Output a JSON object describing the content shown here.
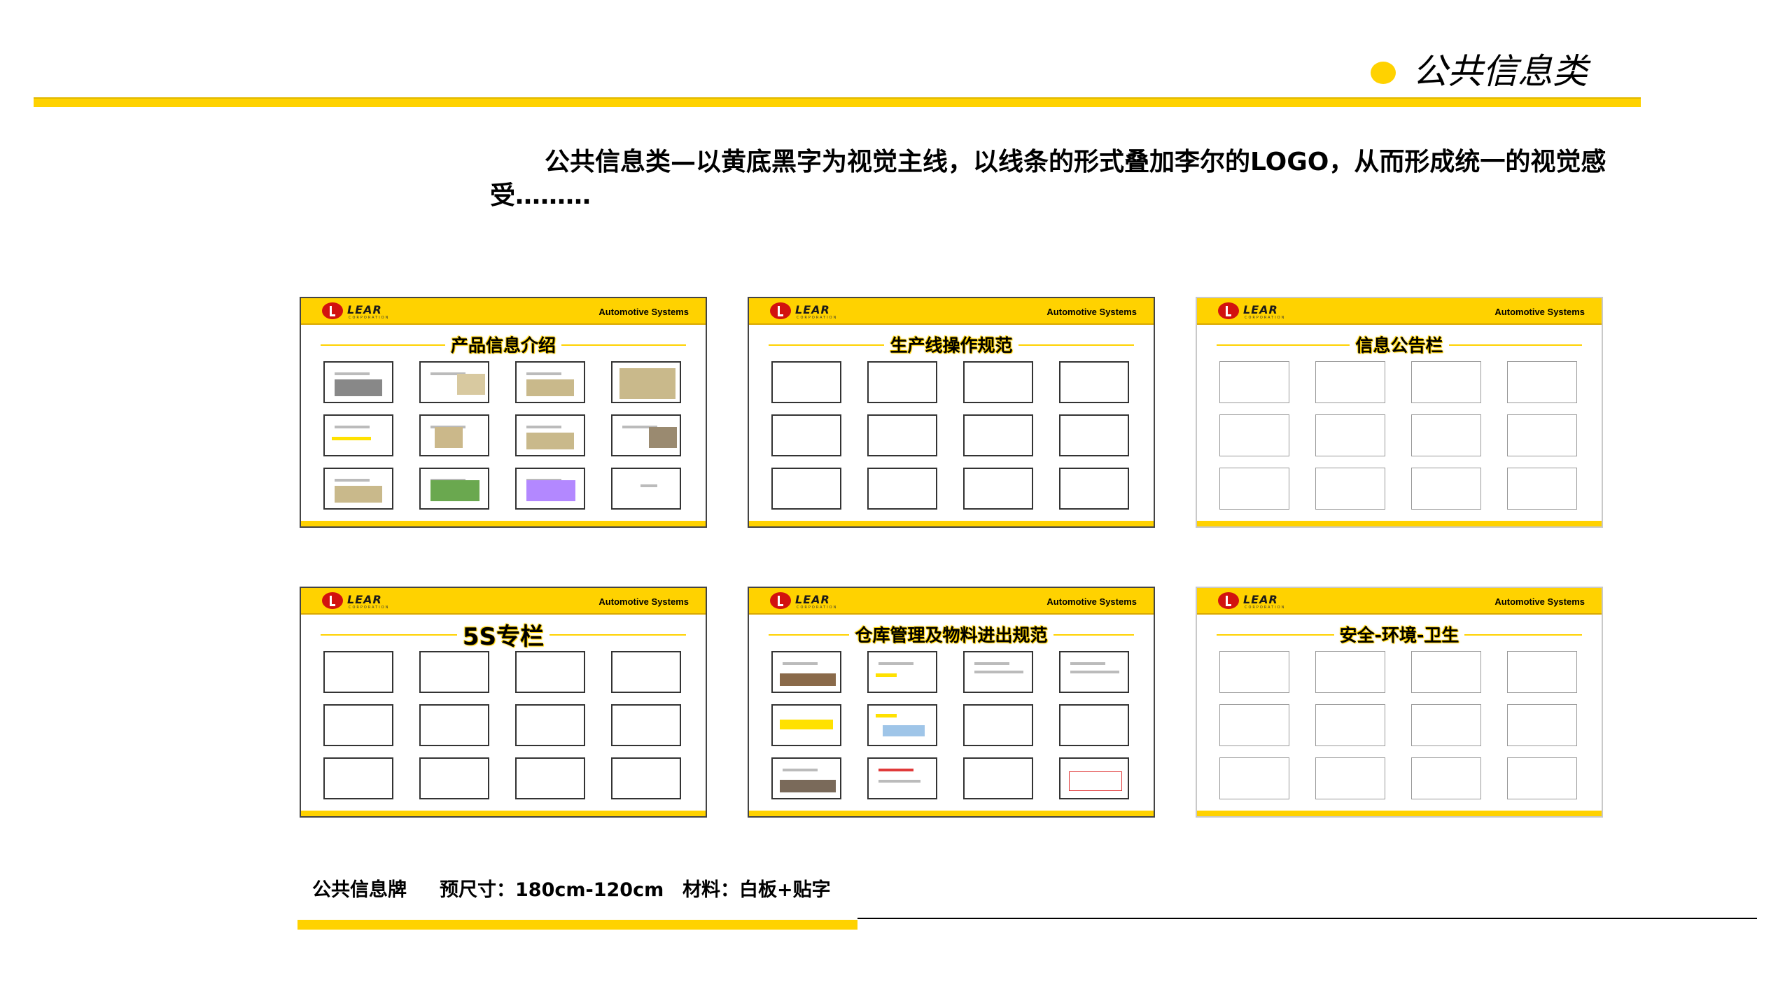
{
  "header": {
    "title": "公共信息类"
  },
  "intro": {
    "text": "公共信息类—以黄底黑字为视觉主线，以线条的形式叠加李尔的LOGO，从而形成统一的视觉感受………"
  },
  "boards": [
    {
      "logo": "LEAR",
      "logo_sub": "CORPORATION",
      "brand": "Automotive Systems",
      "title": "产品信息介绍"
    },
    {
      "logo": "LEAR",
      "logo_sub": "CORPORATION",
      "brand": "Automotive Systems",
      "title": "生产线操作规范"
    },
    {
      "logo": "LEAR",
      "logo_sub": "CORPORATION",
      "brand": "Automotive Systems",
      "title": "信息公告栏"
    },
    {
      "logo": "LEAR",
      "logo_sub": "CORPORATION",
      "brand": "Automotive Systems",
      "title": "5S专栏"
    },
    {
      "logo": "LEAR",
      "logo_sub": "CORPORATION",
      "brand": "Automotive Systems",
      "title": "仓库管理及物料进出规范"
    },
    {
      "logo": "LEAR",
      "logo_sub": "CORPORATION",
      "brand": "Automotive Systems",
      "title": "安全-环境-卫生"
    }
  ],
  "footer": {
    "name": "公共信息牌",
    "size": "预尺寸：180cm-120cm",
    "material": "材料：白板+贴字"
  },
  "colors": {
    "accent": "#ffd200",
    "logo_red": "#d2120f",
    "text": "#000000"
  }
}
